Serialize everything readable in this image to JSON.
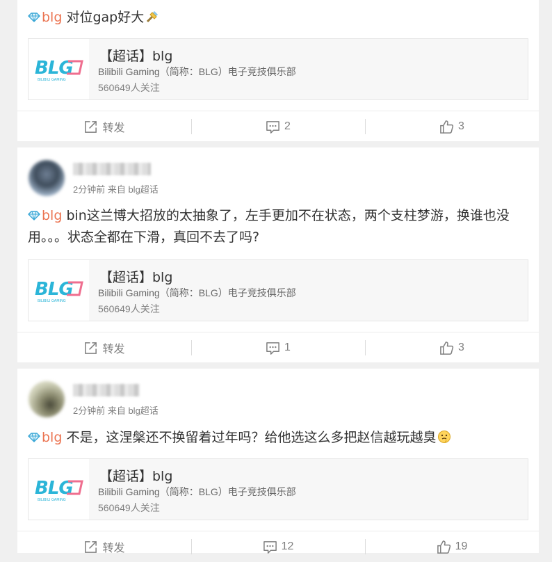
{
  "posts": [
    {
      "id": "post1",
      "topic_tag": "blg",
      "text": " 对位gap好大",
      "topic_card": {
        "title": "【超话】blg",
        "desc": "Bilibili Gaming（简称：BLG）电子竞技俱乐部",
        "followers": "560649人关注",
        "logo_text": "BLG",
        "logo_subtext": "BILIBILI GAMING"
      },
      "actions": {
        "repost": "转发",
        "comments": "2",
        "likes": "3"
      }
    },
    {
      "id": "post2",
      "meta": "2分钟前 来自 blg超话",
      "topic_tag": "blg",
      "text": " bin这兰博大招放的太抽象了，左手更加不在状态，两个支柱梦游，换谁也没用。。。状态全都在下滑，真回不去了吗?",
      "topic_card": {
        "title": "【超话】blg",
        "desc": "Bilibili Gaming（简称：BLG）电子竞技俱乐部",
        "followers": "560649人关注",
        "logo_text": "BLG",
        "logo_subtext": "BILIBILI GAMING"
      },
      "actions": {
        "repost": "转发",
        "comments": "1",
        "likes": "3"
      }
    },
    {
      "id": "post3",
      "meta": "2分钟前 来自 blg超话",
      "topic_tag": "blg",
      "text": " 不是，这涅槃还不换留着过年吗？给他选这么多把赵信越玩越臭",
      "topic_card": {
        "title": "【超话】blg",
        "desc": "Bilibili Gaming（简称：BLG）电子竞技俱乐部",
        "followers": "560649人关注",
        "logo_text": "BLG",
        "logo_subtext": "BILIBILI GAMING"
      },
      "actions": {
        "repost": "转发",
        "comments": "12",
        "likes": "19"
      }
    }
  ],
  "colors": {
    "topic_link": "#eb7350",
    "logo_blue": "#2bb5d8",
    "logo_pink": "#ef6e8f"
  },
  "icons": [
    "diamond-icon",
    "repost-icon",
    "comment-icon",
    "like-icon",
    "emoji-icon"
  ]
}
